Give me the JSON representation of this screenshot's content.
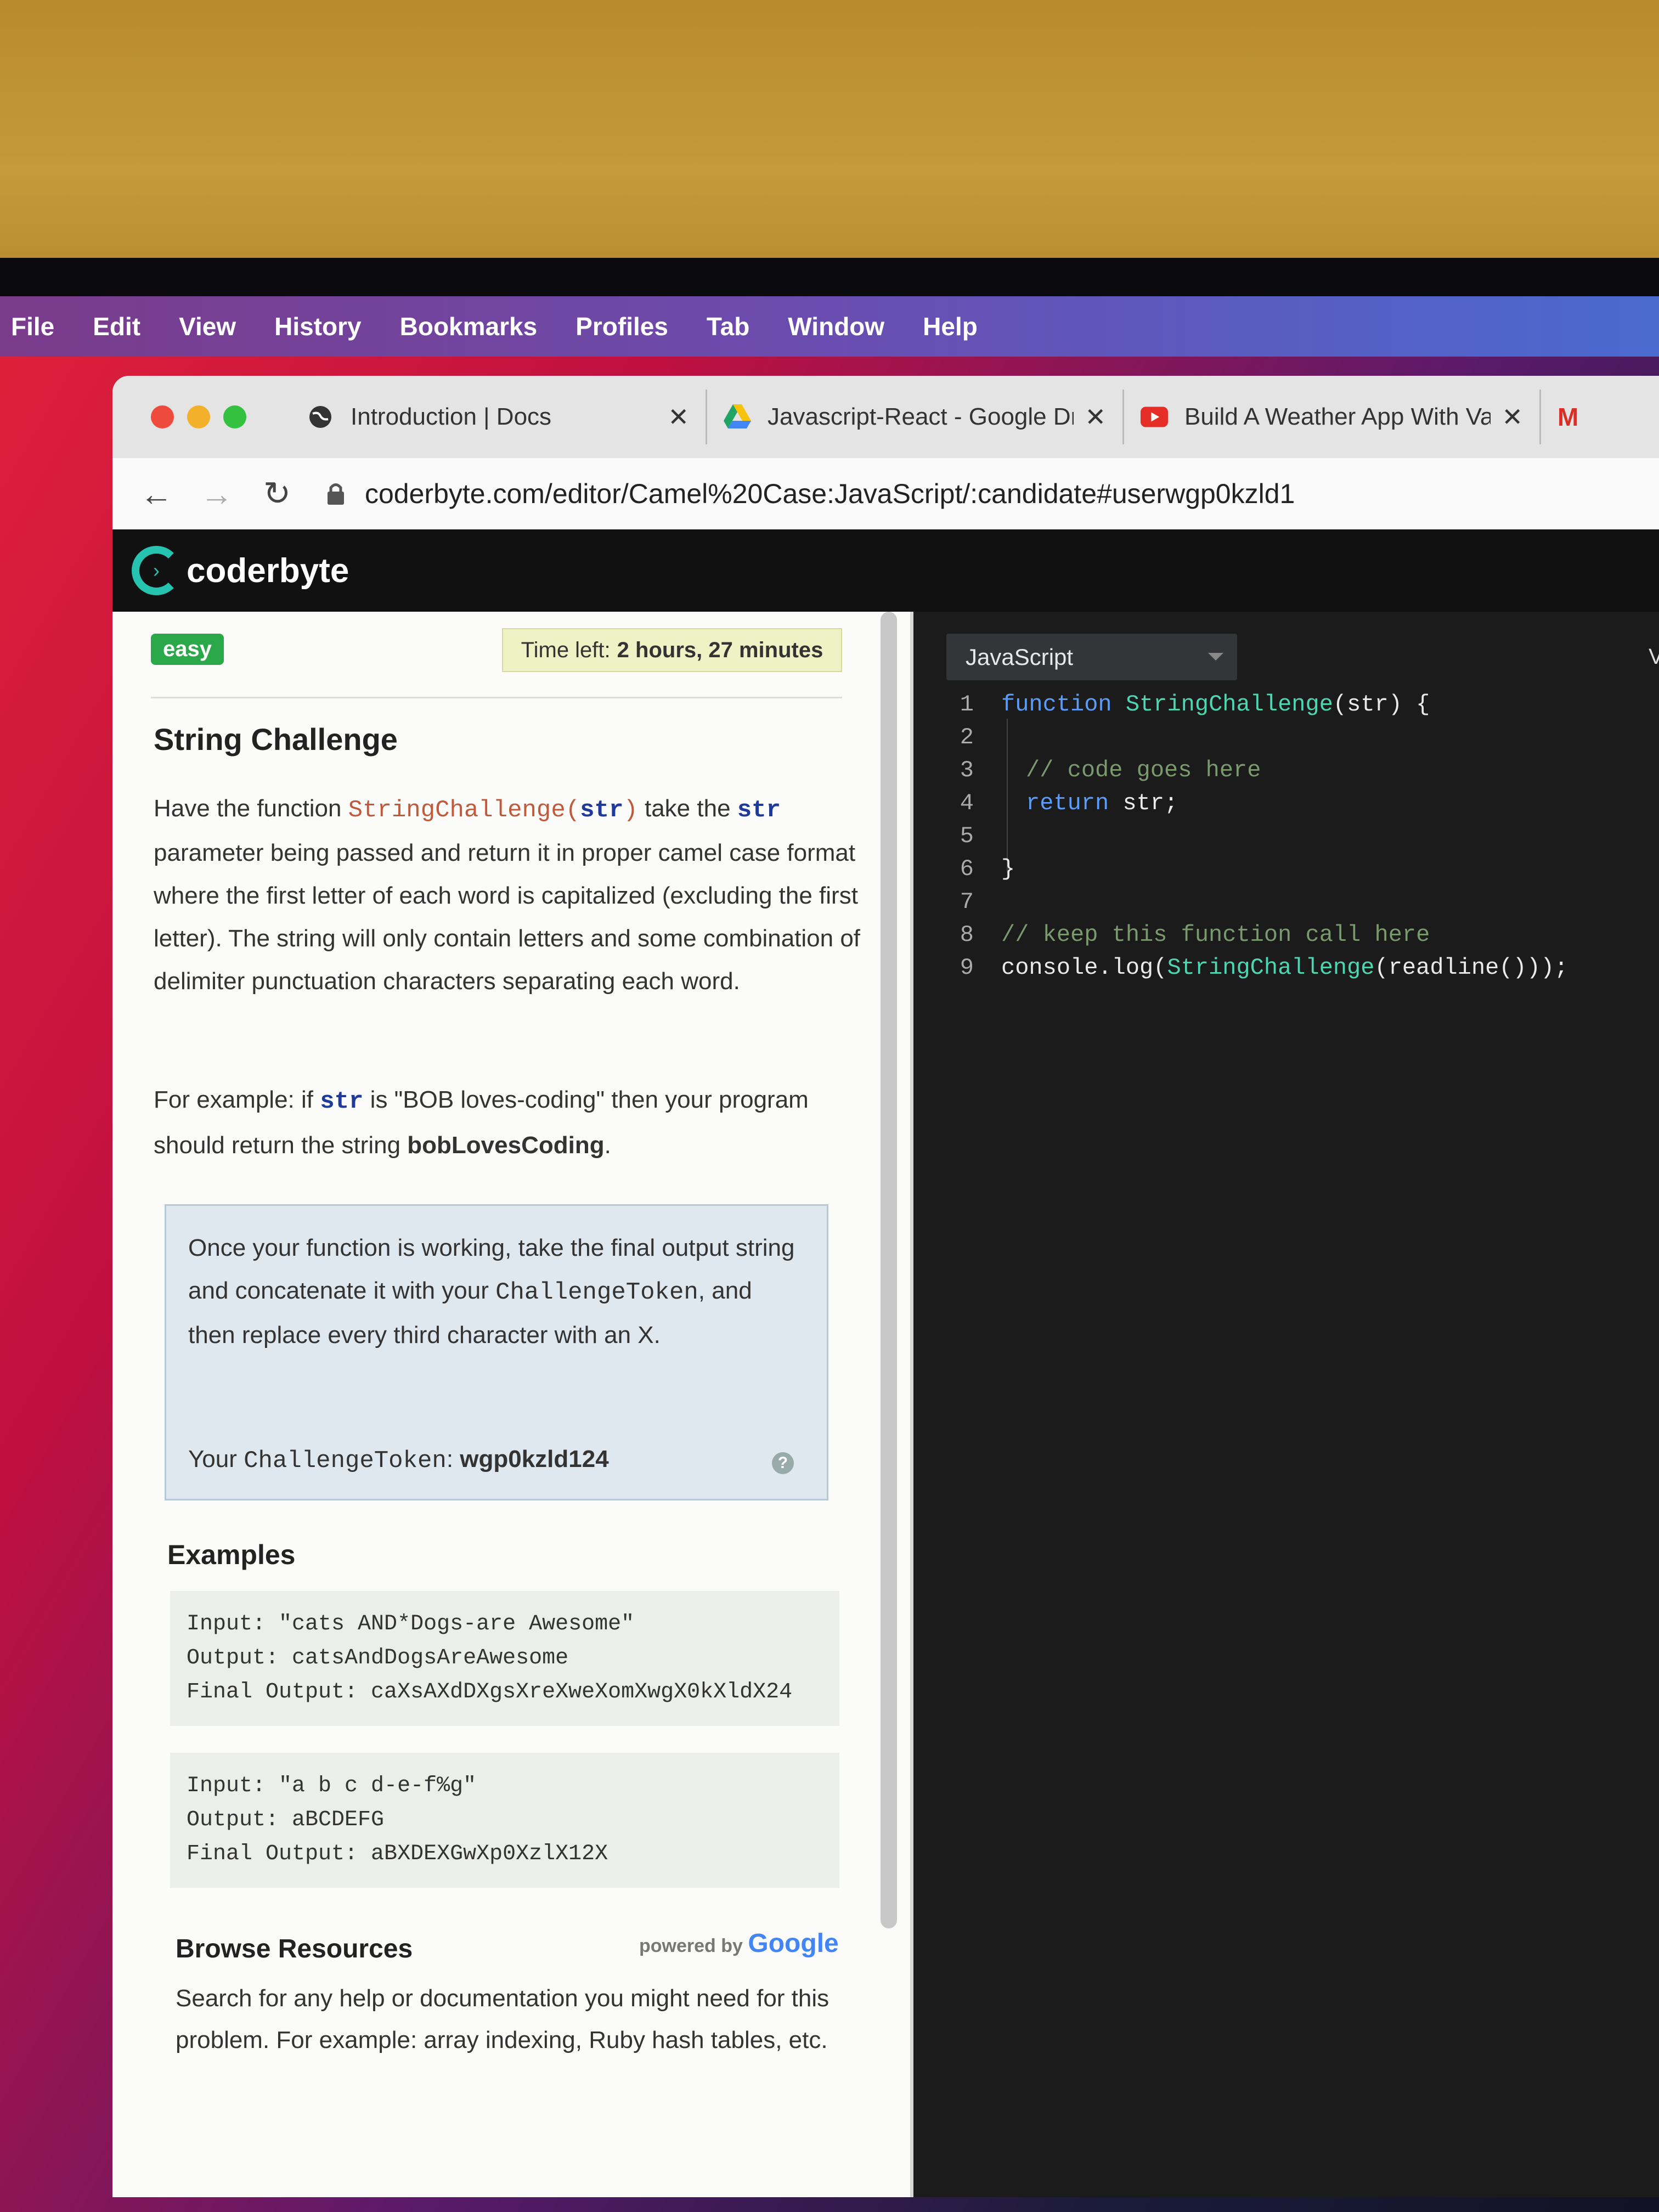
{
  "menubar": {
    "items": [
      "File",
      "Edit",
      "View",
      "History",
      "Bookmarks",
      "Profiles",
      "Tab",
      "Window",
      "Help"
    ]
  },
  "tabs": [
    {
      "title": "Introduction | Docs",
      "icon": "globe-icon"
    },
    {
      "title": "Javascript-React - Google Driv",
      "icon": "google-drive-icon"
    },
    {
      "title": "Build A Weather App With Vani",
      "icon": "youtube-icon"
    }
  ],
  "address_bar": {
    "url": "coderbyte.com/editor/Camel%20Case:JavaScript/:candidate#userwgp0kzld1"
  },
  "app": {
    "name": "coderbyte"
  },
  "challenge": {
    "difficulty": "easy",
    "time_left_label": "Time left:",
    "time_left_value": "2 hours, 27 minutes",
    "title": "String Challenge",
    "desc_p1": "Have the function ",
    "desc_fn": "StringChallenge(",
    "desc_arg": "str",
    "desc_close": ")",
    "desc_p2": " take the ",
    "desc_str": "str",
    "desc_p3": " parameter being passed and return it in proper camel case format where the first letter of each word is capitalized (excluding the first letter). The string will only contain letters and some combination of delimiter punctuation characters separating each word.",
    "ex_p1": "For example: if ",
    "ex_str": "str",
    "ex_p2": " is \"BOB loves-coding\" then your program should return the string ",
    "ex_result": "bobLovesCoding",
    "ex_end": ".",
    "token_p1": "Once your function is working, take the final output string and concatenate it with your ",
    "token_word": "ChallengeToken",
    "token_p2": ", and then replace every third character with an X.",
    "token_label_1": "Your ",
    "token_label_word": "ChallengeToken",
    "token_label_2": ": ",
    "token_value": "wgp0kzld124",
    "examples_title": "Examples",
    "examples": [
      {
        "input": "Input: \"cats AND*Dogs-are Awesome\"",
        "output": "Output: catsAndDogsAreAwesome",
        "final": "Final Output: caXsAXdDXgsXreXweXomXwgX0kXldX24"
      },
      {
        "input": "Input: \"a b c d-e-f%g\"",
        "output": "Output: aBCDEFG",
        "final": "Final Output: aBXDEXGwXp0XzlX12X"
      }
    ],
    "browse_title": "Browse Resources",
    "powered_by": "powered by",
    "google": "Google",
    "browse_text": "Search for any help or documentation you might need for this problem. For example: array indexing, Ruby hash tables, etc."
  },
  "editor": {
    "language": "JavaScript",
    "partial_label": "V",
    "lines": [
      {
        "n": "1"
      },
      {
        "n": "2"
      },
      {
        "n": "3"
      },
      {
        "n": "4"
      },
      {
        "n": "5"
      },
      {
        "n": "6"
      },
      {
        "n": "7"
      },
      {
        "n": "8"
      },
      {
        "n": "9"
      }
    ],
    "code": {
      "l1_kw": "function ",
      "l1_fn": "StringChallenge",
      "l1_rest": "(str) {",
      "l3": "// code goes here",
      "l4_kw": "return ",
      "l4_rest": "str;",
      "l6": "}",
      "l8": "// keep this function call here",
      "l9_a": "console.log(",
      "l9_fn": "StringChallenge",
      "l9_b": "(readline()));"
    }
  },
  "colors": {
    "accent": "#25c3b0",
    "easy": "#2aa84a",
    "editor_bg": "#1b1b1b"
  }
}
